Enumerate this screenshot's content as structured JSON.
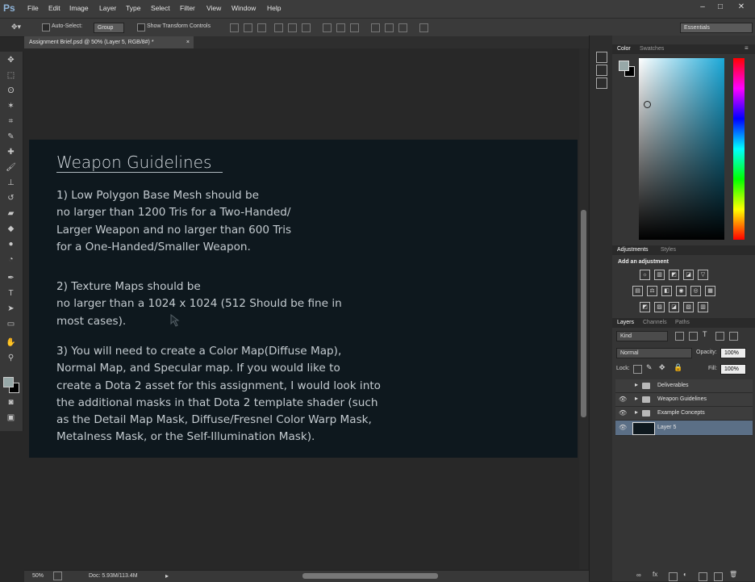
{
  "app": {
    "logo": "Ps"
  },
  "menu": [
    "File",
    "Edit",
    "Image",
    "Layer",
    "Type",
    "Select",
    "Filter",
    "View",
    "Window",
    "Help"
  ],
  "window_controls": {
    "minimize": "–",
    "maximize": "□",
    "close": "✕"
  },
  "options_bar": {
    "auto_select_label": "Auto-Select:",
    "auto_select_value": "Group",
    "show_transform_label": "Show Transform Controls",
    "workspace": "Essentials"
  },
  "document_tab": {
    "title": "Assignment Brief.psd @ 50% (Layer 5, RGB/8#) *",
    "close": "×"
  },
  "artboard": {
    "title": "Weapon Guidelines",
    "p1": "1) Low Polygon Base Mesh should be\nno larger than 1200 Tris for a Two-Handed/\nLarger Weapon and no larger than 600 Tris\nfor a One-Handed/Smaller Weapon.",
    "p2": "2) Texture Maps should be\nno larger than a 1024 x 1024 (512 Should be fine in\nmost cases).",
    "p3": "3) You will need to create a Color Map(Diffuse Map),\nNormal Map, and Specular map. If you would like to\ncreate a Dota 2 asset for this assignment, I would look into\nthe additional masks in that Dota 2 template shader (such\nas the Detail Map Mask, Diffuse/Fresnel Color Warp Mask,\nMetalness Mask, or the Self-Illumination Mask)."
  },
  "status": {
    "zoom": "50%",
    "doc": "Doc: 5.93M/113.4M"
  },
  "color_panel": {
    "tabs": [
      "Color",
      "Swatches"
    ]
  },
  "adjustments_panel": {
    "tabs": [
      "Adjustments",
      "Styles"
    ],
    "heading": "Add an adjustment"
  },
  "layers_panel": {
    "tabs": [
      "Layers",
      "Channels",
      "Paths"
    ],
    "filter": "Kind",
    "blend_mode": "Normal",
    "opacity_label": "Opacity:",
    "opacity": "100%",
    "lock_label": "Lock:",
    "fill_label": "Fill:",
    "fill": "100%",
    "layers": [
      {
        "name": "Deliverables",
        "visible": false,
        "type": "group"
      },
      {
        "name": "Weapon Guidelines",
        "visible": true,
        "type": "group"
      },
      {
        "name": "Example Concepts",
        "visible": true,
        "type": "group"
      },
      {
        "name": "Layer 5",
        "visible": true,
        "type": "layer",
        "selected": true
      }
    ]
  },
  "colors": {
    "accent_selected": "#5b6f86",
    "artboard_bg": "#0e181e",
    "fg_swatch": "#97a8a8",
    "bg_swatch": "#000000"
  }
}
